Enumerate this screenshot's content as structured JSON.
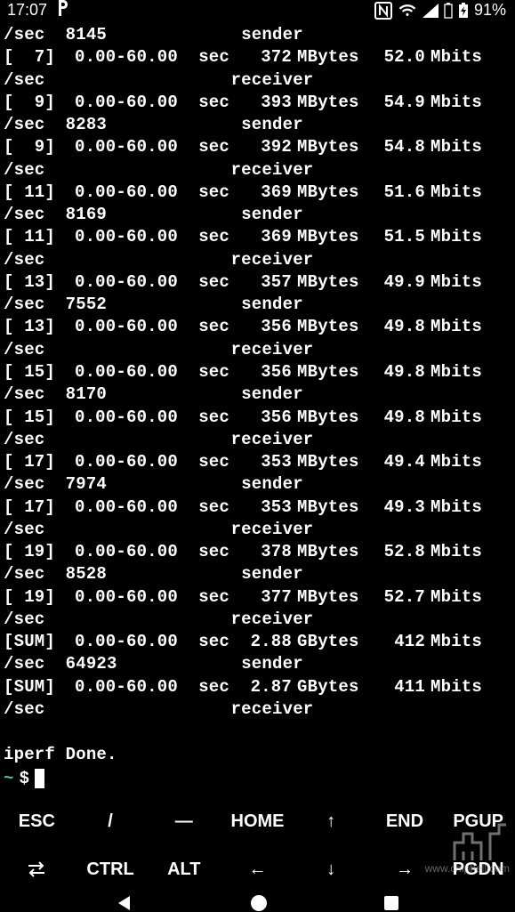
{
  "status_bar": {
    "time": "17:07",
    "battery_pct": "91%"
  },
  "terminal": {
    "rows": [
      {
        "kind": "wrap",
        "left": "/sec  8145",
        "right": "sender"
      },
      {
        "kind": "data",
        "id": "[  7]",
        "interval": "0.00-60.00",
        "sec": "sec",
        "xfer": "372",
        "xu": "MBytes",
        "bw": "52.0",
        "bu": "Mbits"
      },
      {
        "kind": "wrap",
        "left": "/sec",
        "right": "receiver"
      },
      {
        "kind": "data",
        "id": "[  9]",
        "interval": "0.00-60.00",
        "sec": "sec",
        "xfer": "393",
        "xu": "MBytes",
        "bw": "54.9",
        "bu": "Mbits"
      },
      {
        "kind": "wrap",
        "left": "/sec  8283",
        "right": "sender"
      },
      {
        "kind": "data",
        "id": "[  9]",
        "interval": "0.00-60.00",
        "sec": "sec",
        "xfer": "392",
        "xu": "MBytes",
        "bw": "54.8",
        "bu": "Mbits"
      },
      {
        "kind": "wrap",
        "left": "/sec",
        "right": "receiver"
      },
      {
        "kind": "data",
        "id": "[ 11]",
        "interval": "0.00-60.00",
        "sec": "sec",
        "xfer": "369",
        "xu": "MBytes",
        "bw": "51.6",
        "bu": "Mbits"
      },
      {
        "kind": "wrap",
        "left": "/sec  8169",
        "right": "sender"
      },
      {
        "kind": "data",
        "id": "[ 11]",
        "interval": "0.00-60.00",
        "sec": "sec",
        "xfer": "369",
        "xu": "MBytes",
        "bw": "51.5",
        "bu": "Mbits"
      },
      {
        "kind": "wrap",
        "left": "/sec",
        "right": "receiver"
      },
      {
        "kind": "data",
        "id": "[ 13]",
        "interval": "0.00-60.00",
        "sec": "sec",
        "xfer": "357",
        "xu": "MBytes",
        "bw": "49.9",
        "bu": "Mbits"
      },
      {
        "kind": "wrap",
        "left": "/sec  7552",
        "right": "sender"
      },
      {
        "kind": "data",
        "id": "[ 13]",
        "interval": "0.00-60.00",
        "sec": "sec",
        "xfer": "356",
        "xu": "MBytes",
        "bw": "49.8",
        "bu": "Mbits"
      },
      {
        "kind": "wrap",
        "left": "/sec",
        "right": "receiver"
      },
      {
        "kind": "data",
        "id": "[ 15]",
        "interval": "0.00-60.00",
        "sec": "sec",
        "xfer": "356",
        "xu": "MBytes",
        "bw": "49.8",
        "bu": "Mbits"
      },
      {
        "kind": "wrap",
        "left": "/sec  8170",
        "right": "sender"
      },
      {
        "kind": "data",
        "id": "[ 15]",
        "interval": "0.00-60.00",
        "sec": "sec",
        "xfer": "356",
        "xu": "MBytes",
        "bw": "49.8",
        "bu": "Mbits"
      },
      {
        "kind": "wrap",
        "left": "/sec",
        "right": "receiver"
      },
      {
        "kind": "data",
        "id": "[ 17]",
        "interval": "0.00-60.00",
        "sec": "sec",
        "xfer": "353",
        "xu": "MBytes",
        "bw": "49.4",
        "bu": "Mbits"
      },
      {
        "kind": "wrap",
        "left": "/sec  7974",
        "right": "sender"
      },
      {
        "kind": "data",
        "id": "[ 17]",
        "interval": "0.00-60.00",
        "sec": "sec",
        "xfer": "353",
        "xu": "MBytes",
        "bw": "49.3",
        "bu": "Mbits"
      },
      {
        "kind": "wrap",
        "left": "/sec",
        "right": "receiver"
      },
      {
        "kind": "data",
        "id": "[ 19]",
        "interval": "0.00-60.00",
        "sec": "sec",
        "xfer": "378",
        "xu": "MBytes",
        "bw": "52.8",
        "bu": "Mbits"
      },
      {
        "kind": "wrap",
        "left": "/sec  8528",
        "right": "sender"
      },
      {
        "kind": "data",
        "id": "[ 19]",
        "interval": "0.00-60.00",
        "sec": "sec",
        "xfer": "377",
        "xu": "MBytes",
        "bw": "52.7",
        "bu": "Mbits"
      },
      {
        "kind": "wrap",
        "left": "/sec",
        "right": "receiver"
      },
      {
        "kind": "data",
        "id": "[SUM]",
        "interval": "0.00-60.00",
        "sec": "sec",
        "xfer": "2.88",
        "xu": "GBytes",
        "bw": "412",
        "bu": "Mbits"
      },
      {
        "kind": "wrap",
        "left": "/sec  64923",
        "right": "sender"
      },
      {
        "kind": "data",
        "id": "[SUM]",
        "interval": "0.00-60.00",
        "sec": "sec",
        "xfer": "2.87",
        "xu": "GBytes",
        "bw": "411",
        "bu": "Mbits"
      },
      {
        "kind": "wrap",
        "left": "/sec",
        "right": "receiver"
      },
      {
        "kind": "blank"
      },
      {
        "kind": "text",
        "text": "iperf Done."
      }
    ],
    "prompt": {
      "tilde": "~",
      "dollar": "$"
    }
  },
  "keys": {
    "row1": [
      "ESC",
      "/",
      "—",
      "HOME",
      "↑",
      "END",
      "PGUP"
    ],
    "row2_ctrl": "CTRL",
    "row2_alt": "ALT",
    "row2": [
      "←",
      "↓",
      "→",
      "PGDN"
    ]
  },
  "watermark": "www.chiphell.com"
}
